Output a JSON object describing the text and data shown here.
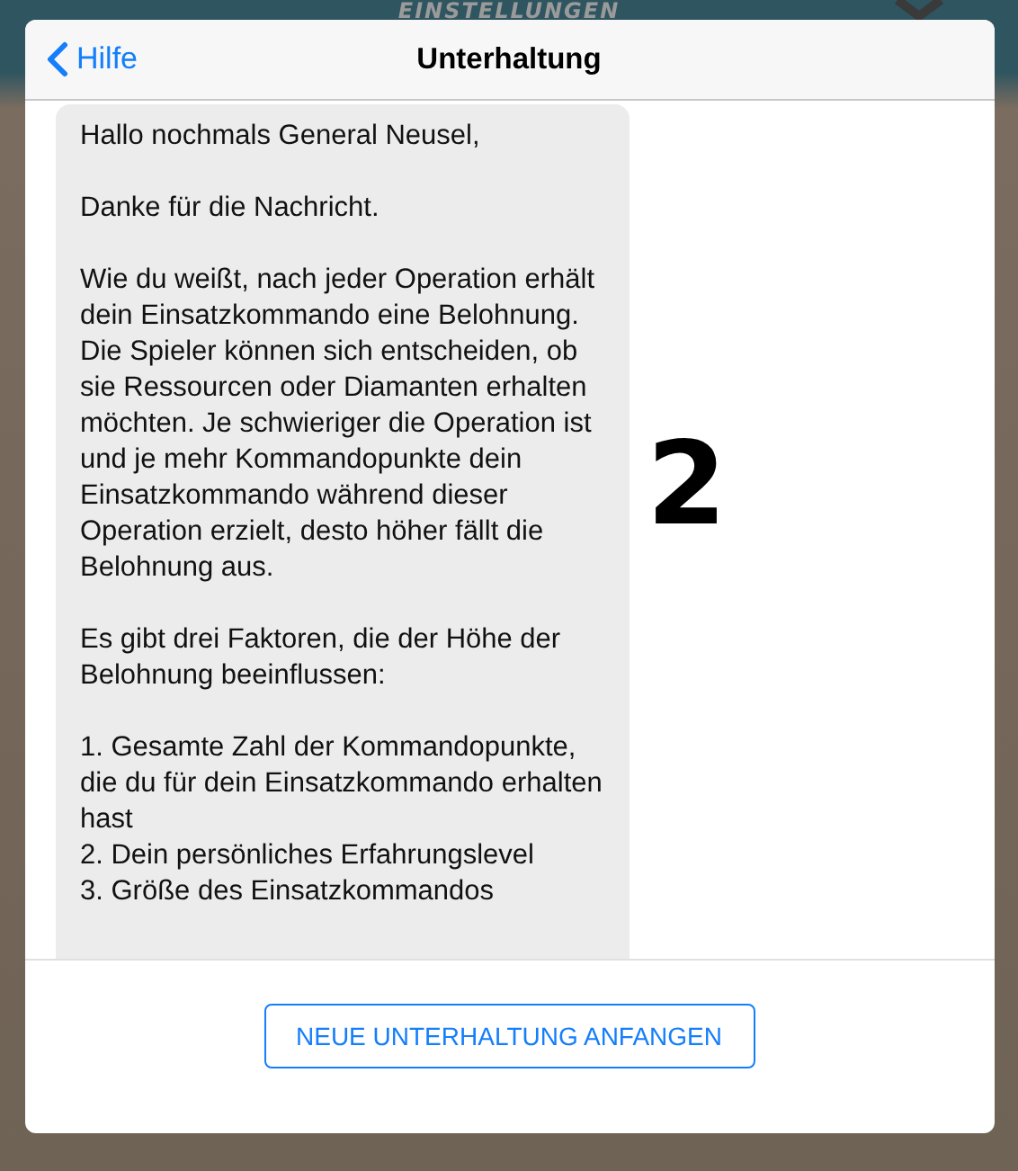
{
  "background": {
    "title": "EINSTELLUNGEN"
  },
  "header": {
    "back": "Hilfe",
    "title": "Unterhaltung"
  },
  "message": {
    "paragraphs": [
      [
        "Hallo nochmals General Neusel,"
      ],
      [
        "Danke für die Nachricht."
      ],
      [
        "Wie du weißt, nach jeder Operation erhält dein Einsatzkommando eine Belohnung. Die Spieler können sich entscheiden, ob sie Ressourcen oder Diamanten erhalten möchten. Je schwieriger die Operation ist und je mehr Kommandopunkte dein Einsatzkommando während dieser Operation erzielt, desto höher fällt die Belohnung aus."
      ],
      [
        "Es gibt drei Faktoren, die der Höhe der Belohnung beeinflussen:"
      ],
      [
        "1. Gesamte Zahl der Kommandopunkte, die du für dein Einsatzkommando erhalten hast",
        "2. Dein persönliches Erfahrungslevel",
        "3. Größe des Einsatzkommandos"
      ]
    ]
  },
  "annotation": "2",
  "footer": {
    "button": "NEUE UNTERHALTUNG ANFANGEN"
  }
}
